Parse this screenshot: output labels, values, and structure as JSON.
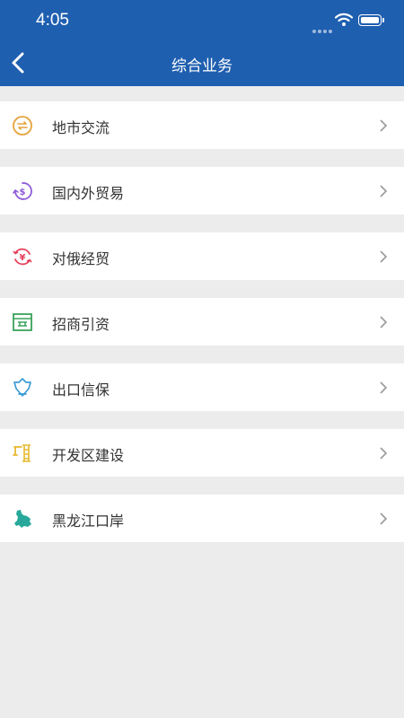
{
  "status_bar": {
    "time": "4:05"
  },
  "nav": {
    "title": "综合业务",
    "back_icon": "chevron-left-icon"
  },
  "menu": {
    "items": [
      {
        "label": "地市交流",
        "icon": "exchange-icon",
        "color": "#e6a23c"
      },
      {
        "label": "国内外贸易",
        "icon": "dollar-trade-icon",
        "color": "#8e5cd8"
      },
      {
        "label": "对俄经贸",
        "icon": "yuan-cycle-icon",
        "color": "#e6405a"
      },
      {
        "label": "招商引资",
        "icon": "merchant-icon",
        "color": "#3aa35b"
      },
      {
        "label": "出口信保",
        "icon": "shield-icon",
        "color": "#3b9bd6"
      },
      {
        "label": "开发区建设",
        "icon": "crane-icon",
        "color": "#e6b82e"
      },
      {
        "label": "黑龙江口岸",
        "icon": "province-map-icon",
        "color": "#27a89a"
      }
    ]
  }
}
